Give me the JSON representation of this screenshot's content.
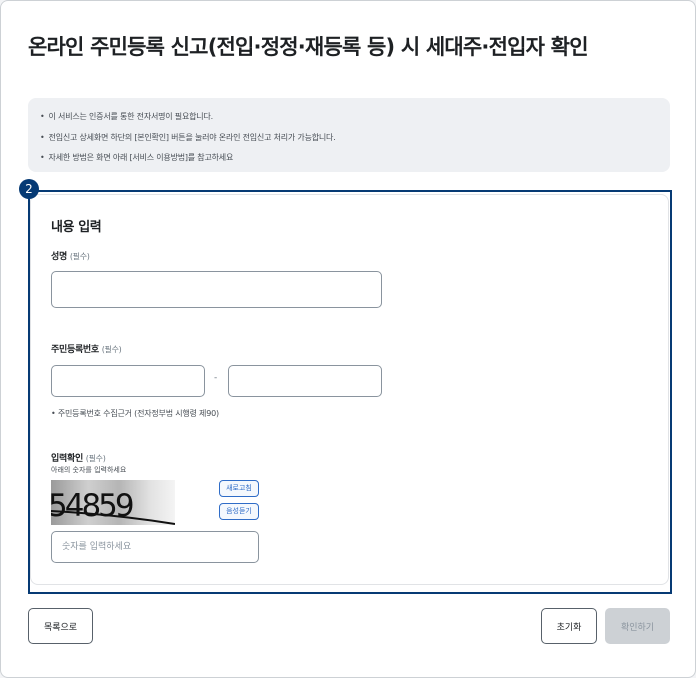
{
  "page": {
    "title": "온라인 주민등록 신고(전입·정정·재등록 등) 시 세대주·전입자 확인"
  },
  "notice": {
    "items": [
      "이 서비스는 인증서를 통한 전자서명이 필요합니다.",
      "전입신고 상세화면 하단의 [본인확인] 버튼을 눌러야 온라인 전입신고 처리가 가능합니다.",
      "자세한 방법은 화면 아래 [서비스 이용방법]를 참고하세요"
    ]
  },
  "step": {
    "number": "2"
  },
  "form": {
    "section_title": "내용 입력",
    "name": {
      "label": "성명",
      "required": "(필수)",
      "value": ""
    },
    "rrn": {
      "label": "주민등록번호",
      "required": "(필수)",
      "front_value": "",
      "back_value": "",
      "separator": "-",
      "hint": "• 주민등록번호 수집근거 (전자정부법 시행령 제90)"
    },
    "captcha": {
      "label": "입력확인",
      "required": "(필수)",
      "sub_label": "아래의 숫자를 입력하세요",
      "image_text": "54859",
      "refresh_label": "새로고침",
      "audio_label": "음성듣기",
      "input_placeholder": "숫자를 입력하세요"
    }
  },
  "footer": {
    "list_button": "목록으로",
    "reset_button": "초기화",
    "confirm_button": "확인하기"
  },
  "colors": {
    "primary_navy": "#063a74",
    "link_blue": "#2f6cc7",
    "notice_bg": "#eef0f3",
    "disabled_bg": "#cdd1d5"
  }
}
